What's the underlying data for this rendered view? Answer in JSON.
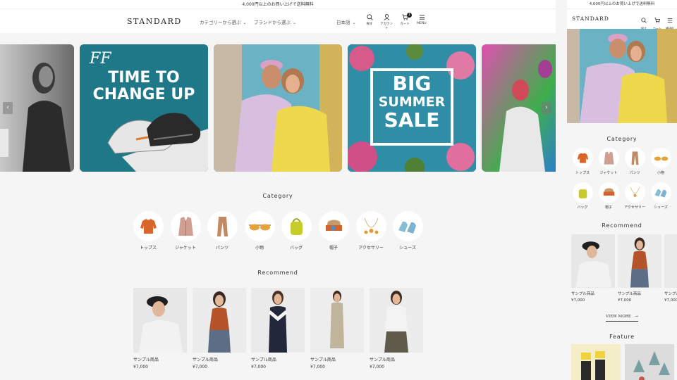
{
  "announcement": "4,000円以上のお買い上げで送料無料",
  "header": {
    "logo": "STANDARD",
    "nav": [
      {
        "label": "カテゴリーから選ぶ"
      },
      {
        "label": "ブランドから選ぶ"
      }
    ],
    "language": "日本語",
    "icons": {
      "search": "探す",
      "account": "アカウント",
      "cart": "カート",
      "cart_count": "1",
      "menu": "MENU"
    }
  },
  "hero": {
    "slides": [
      {
        "name": "woman-portrait"
      },
      {
        "name": "sneakers",
        "line1": "TIME TO",
        "line2": "CHANGE UP",
        "mark": "FF"
      },
      {
        "name": "couple"
      },
      {
        "name": "big-summer-sale",
        "line1": "BIG",
        "line2": "SUMMER",
        "line3": "SALE"
      },
      {
        "name": "colorful-portrait"
      }
    ],
    "prev": "‹",
    "next": "›"
  },
  "category": {
    "title": "Category",
    "items": [
      {
        "label": "トップス",
        "icon": "tops-icon"
      },
      {
        "label": "ジャケット",
        "icon": "jacket-icon"
      },
      {
        "label": "パンツ",
        "icon": "pants-icon"
      },
      {
        "label": "小物",
        "icon": "sunglasses-icon"
      },
      {
        "label": "バッグ",
        "icon": "bag-icon"
      },
      {
        "label": "帽子",
        "icon": "hat-icon"
      },
      {
        "label": "アクセサリー",
        "icon": "accessory-icon"
      },
      {
        "label": "シューズ",
        "icon": "shoes-icon"
      }
    ]
  },
  "recommend": {
    "title": "Recommend",
    "products": [
      {
        "name": "サンプル商品",
        "price": "¥7,000"
      },
      {
        "name": "サンプル商品",
        "price": "¥7,000"
      },
      {
        "name": "サンプル商品",
        "price": "¥7,000"
      },
      {
        "name": "サンプル商品",
        "price": "¥7,000"
      },
      {
        "name": "サンプル商品",
        "price": "¥7,000"
      }
    ],
    "view_more": "VIEW MORE",
    "view_more_arrow": "→"
  },
  "feature": {
    "title": "Feature"
  },
  "colors": {
    "accent": "#222222",
    "background": "#f5f5f5"
  }
}
